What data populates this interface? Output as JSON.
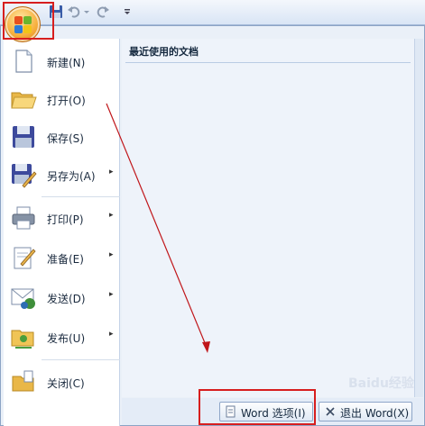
{
  "quick_access": {
    "icons": [
      "save-icon",
      "undo-icon",
      "dropdown-icon",
      "redo-icon",
      "customize-icon"
    ]
  },
  "office_button": {
    "icon": "office-logo-icon"
  },
  "menu": {
    "items": [
      {
        "label": "新建(N)",
        "icon": "new-document-icon",
        "has_submenu": false
      },
      {
        "label": "打开(O)",
        "icon": "open-folder-icon",
        "has_submenu": false
      },
      {
        "label": "保存(S)",
        "icon": "save-disk-icon",
        "has_submenu": false
      },
      {
        "label": "另存为(A)",
        "icon": "save-as-icon",
        "has_submenu": true
      },
      {
        "label": "打印(P)",
        "icon": "printer-icon",
        "has_submenu": true
      },
      {
        "label": "准备(E)",
        "icon": "prepare-icon",
        "has_submenu": true
      },
      {
        "label": "发送(D)",
        "icon": "send-icon",
        "has_submenu": true
      },
      {
        "label": "发布(U)",
        "icon": "publish-icon",
        "has_submenu": true
      },
      {
        "label": "关闭(C)",
        "icon": "close-folder-icon",
        "has_submenu": false
      }
    ],
    "submenu_arrow": "▸"
  },
  "recent_documents": {
    "title": "最近使用的文档"
  },
  "buttons": {
    "word_options": "Word 选项(I)",
    "exit_word": "退出 Word(X)"
  },
  "watermark": "Baidu经验",
  "colors": {
    "highlight": "#d71e1e",
    "arrow": "#c0161a",
    "office_orange": "#f7b13f"
  }
}
